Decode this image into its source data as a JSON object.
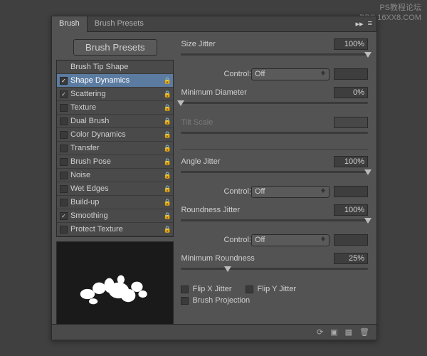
{
  "watermark": {
    "line1": "PS教程论坛",
    "line2": "BBS.16XX8.COM"
  },
  "tabs": {
    "brush": "Brush",
    "presets": "Brush Presets"
  },
  "preset_button": "Brush Presets",
  "options": [
    {
      "label": "Brush Tip Shape",
      "checked": false,
      "locked": false,
      "nocheck": true
    },
    {
      "label": "Shape Dynamics",
      "checked": true,
      "locked": true,
      "selected": true
    },
    {
      "label": "Scattering",
      "checked": true,
      "locked": true
    },
    {
      "label": "Texture",
      "checked": false,
      "locked": true
    },
    {
      "label": "Dual Brush",
      "checked": false,
      "locked": true
    },
    {
      "label": "Color Dynamics",
      "checked": false,
      "locked": true
    },
    {
      "label": "Transfer",
      "checked": false,
      "locked": true
    },
    {
      "label": "Brush Pose",
      "checked": false,
      "locked": true
    },
    {
      "label": "Noise",
      "checked": false,
      "locked": true
    },
    {
      "label": "Wet Edges",
      "checked": false,
      "locked": true
    },
    {
      "label": "Build-up",
      "checked": false,
      "locked": true
    },
    {
      "label": "Smoothing",
      "checked": true,
      "locked": true
    },
    {
      "label": "Protect Texture",
      "checked": false,
      "locked": true
    }
  ],
  "settings": {
    "size_jitter": {
      "label": "Size Jitter",
      "value": "100%",
      "pos": 100
    },
    "control1": {
      "label": "Control:",
      "value": "Off"
    },
    "min_diameter": {
      "label": "Minimum Diameter",
      "value": "0%",
      "pos": 0
    },
    "tilt_scale": {
      "label": "Tilt Scale",
      "value": "",
      "pos": 0
    },
    "angle_jitter": {
      "label": "Angle Jitter",
      "value": "100%",
      "pos": 100
    },
    "control2": {
      "label": "Control:",
      "value": "Off"
    },
    "roundness_jitter": {
      "label": "Roundness Jitter",
      "value": "100%",
      "pos": 100
    },
    "control3": {
      "label": "Control:",
      "value": "Off"
    },
    "min_roundness": {
      "label": "Minimum Roundness",
      "value": "25%",
      "pos": 25
    },
    "flip_x": "Flip X Jitter",
    "flip_y": "Flip Y Jitter",
    "brush_proj": "Brush Projection"
  }
}
